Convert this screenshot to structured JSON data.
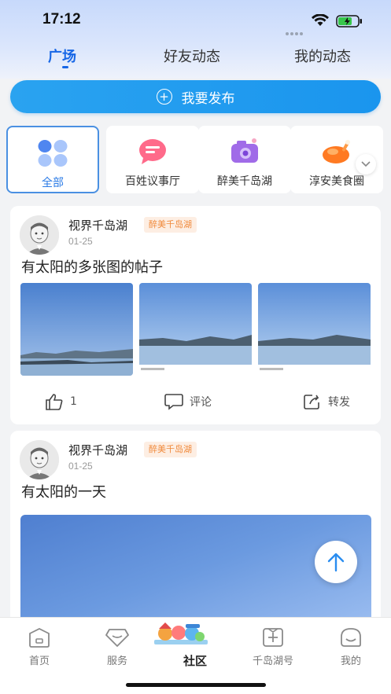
{
  "status_bar": {
    "time": "17:12"
  },
  "tabs": [
    {
      "label": "广场",
      "active": true
    },
    {
      "label": "好友动态",
      "active": false
    },
    {
      "label": "我的动态",
      "active": false
    }
  ],
  "publish": {
    "label": "我要发布"
  },
  "categories": [
    {
      "label": "全部",
      "icon": "grid-icon",
      "active": true
    },
    {
      "label": "百姓议事厅",
      "icon": "chat-bubble-icon",
      "active": false
    },
    {
      "label": "醉美千岛湖",
      "icon": "camera-icon",
      "active": false
    },
    {
      "label": "淳安美食圈",
      "icon": "roast-chicken-icon",
      "active": false
    }
  ],
  "posts": [
    {
      "author": "视界千岛湖",
      "badge": "醉美千岛湖",
      "date": "01-25",
      "title": "有太阳的多张图的帖子",
      "likes": "1",
      "comment_label": "评论",
      "share_label": "转发"
    },
    {
      "author": "视界千岛湖",
      "badge": "醉美千岛湖",
      "date": "01-25",
      "title": "有太阳的一天"
    }
  ],
  "bottom_nav": [
    {
      "label": "首页",
      "active": false
    },
    {
      "label": "服务",
      "active": false
    },
    {
      "label": "社区",
      "active": true
    },
    {
      "label": "千岛湖号",
      "active": false
    },
    {
      "label": "我的",
      "active": false
    }
  ],
  "colors": {
    "accent": "#1666e6",
    "publish": "#1a95ee",
    "badge_text": "#f08a3c"
  }
}
